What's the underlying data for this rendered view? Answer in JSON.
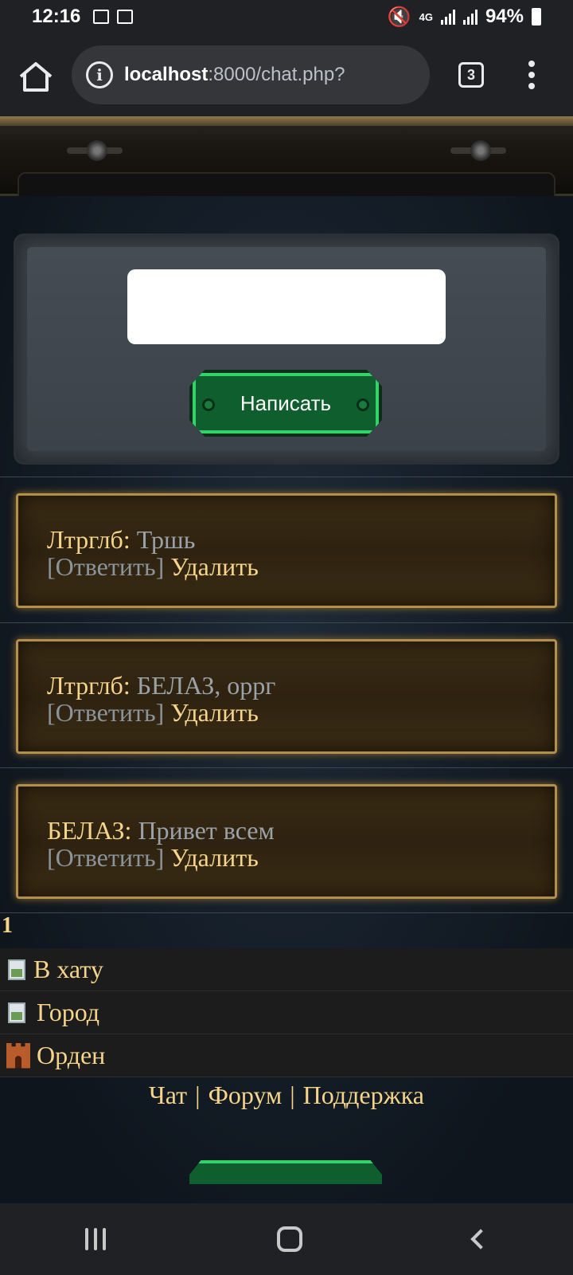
{
  "status_bar": {
    "time": "12:16",
    "network": "4G",
    "battery": "94%"
  },
  "browser": {
    "url_host": "localhost",
    "url_rest": ":8000/chat.php?",
    "tab_count": "3"
  },
  "compose": {
    "input_value": "",
    "write_label": "Написать"
  },
  "messages": [
    {
      "author": "Лтрглб",
      "text": "Тршь",
      "reply": "[Ответить]",
      "delete": "Удалить"
    },
    {
      "author": "Лтрглб",
      "text": "БЕЛАЗ, оррг",
      "reply": "[Ответить]",
      "delete": "Удалить"
    },
    {
      "author": "БЕЛАЗ",
      "text": "Привет всем",
      "reply": "[Ответить]",
      "delete": "Удалить"
    }
  ],
  "pager": {
    "current": "1"
  },
  "nav": [
    {
      "label": "В хату",
      "icon": "broken-image-icon"
    },
    {
      "label": "Город",
      "icon": "broken-image-icon"
    },
    {
      "label": "Орден",
      "icon": "castle-icon"
    }
  ],
  "footer": {
    "chat": "Чат",
    "forum": "Форум",
    "support": "Поддержка",
    "separator": "|"
  },
  "colors": {
    "gold": "#f6d58a",
    "muted": "#9aa2a9",
    "green": "#33d36a"
  }
}
